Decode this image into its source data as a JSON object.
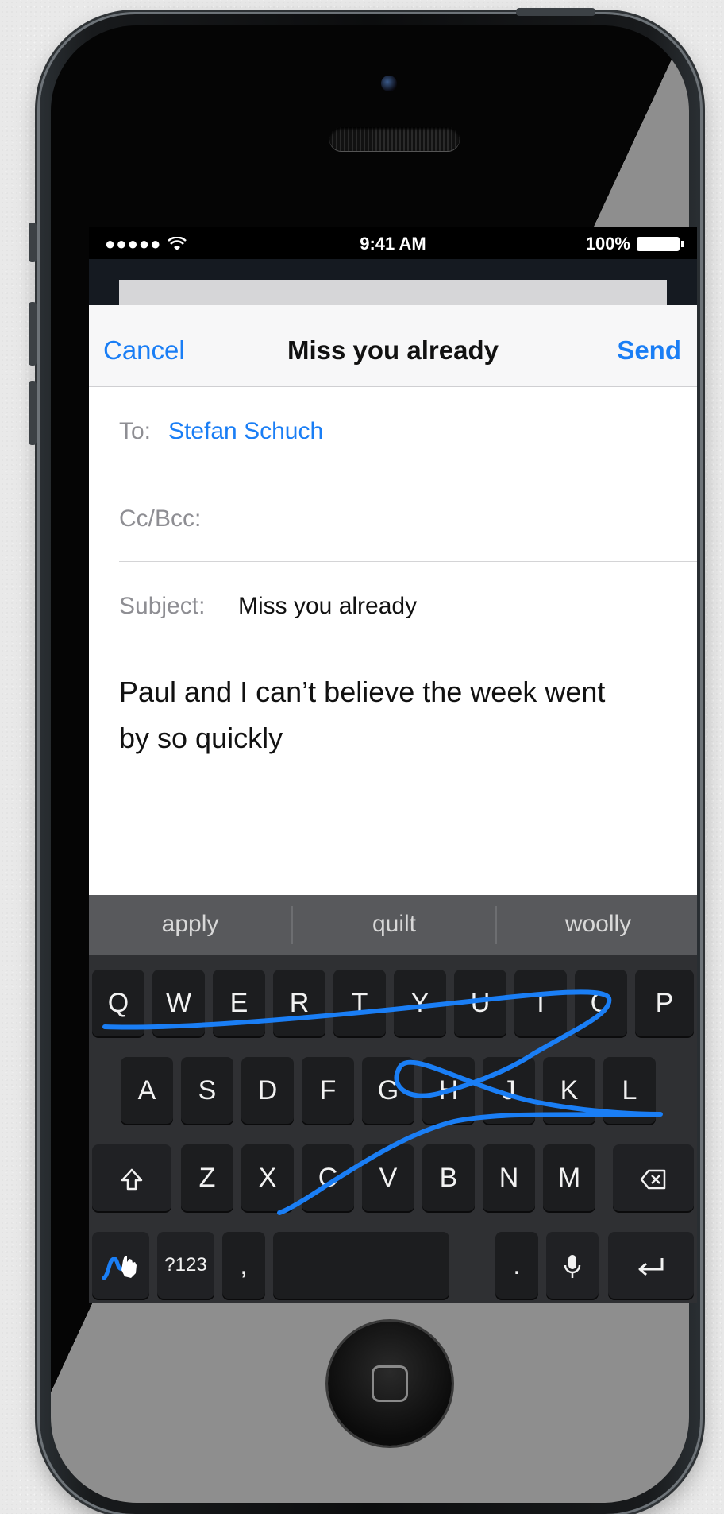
{
  "status": {
    "signal": "●●●●●",
    "time": "9:41 AM",
    "battery": "100%"
  },
  "nav": {
    "cancel": "Cancel",
    "title": "Miss you already",
    "send": "Send"
  },
  "fields": {
    "to_label": "To:",
    "to_value": "Stefan Schuch",
    "cc_label": "Cc/Bcc:",
    "subject_label": "Subject:",
    "subject_value": "Miss you already"
  },
  "body": {
    "text": "Paul and I can’t believe the week went by so quickly"
  },
  "suggestions": [
    "apply",
    "quilt",
    "woolly"
  ],
  "keyboard": {
    "row1": [
      "Q",
      "W",
      "E",
      "R",
      "T",
      "Y",
      "U",
      "I",
      "O",
      "P"
    ],
    "row2": [
      "A",
      "S",
      "D",
      "F",
      "G",
      "H",
      "J",
      "K",
      "L"
    ],
    "row3": [
      "Z",
      "X",
      "C",
      "V",
      "B",
      "N",
      "M"
    ],
    "numbers": "?123",
    "comma": ",",
    "period": "."
  },
  "colors": {
    "accent": "#1a7ef5",
    "swype_trail": "#1a7ef5"
  }
}
